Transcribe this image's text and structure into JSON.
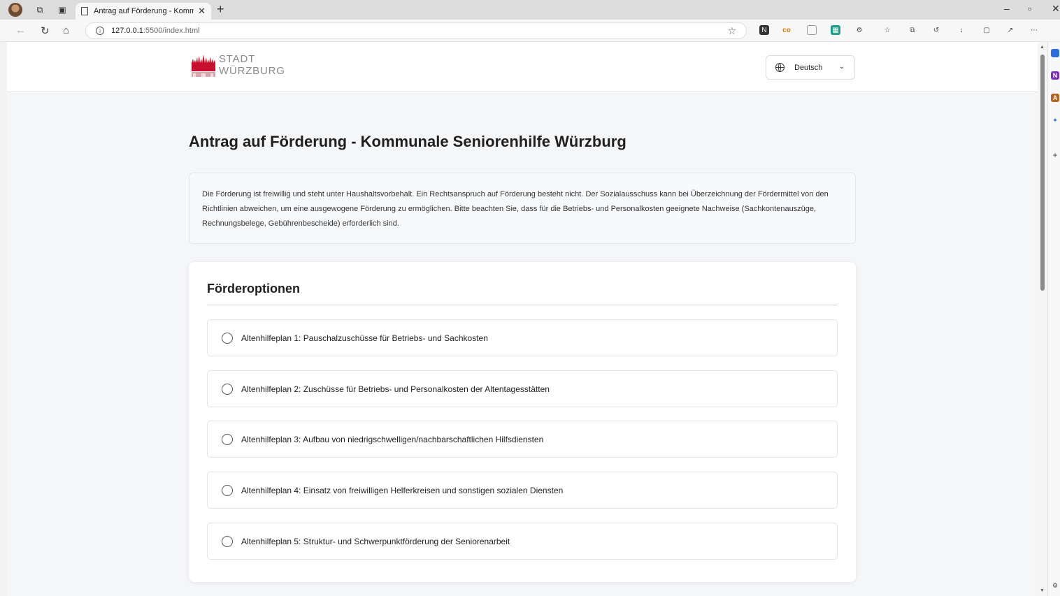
{
  "browser": {
    "tab_title": "Antrag auf Förderung - Kommuna",
    "url_host": "127.0.0.1",
    "url_path": ":5500/index.html"
  },
  "header": {
    "logo_line1": "STADT",
    "logo_line2": "WÜRZBURG",
    "language": "Deutsch"
  },
  "main": {
    "title": "Antrag auf Förderung - Kommunale Seniorenhilfe Würzburg",
    "notice": "Die Förderung ist freiwillig und steht unter Haushaltsvorbehalt. Ein Rechtsanspruch auf Förderung besteht nicht. Der Sozialausschuss kann bei Überzeichnung der Fördermittel von den Richtlinien abweichen, um eine ausgewogene Förderung zu ermöglichen. Bitte beachten Sie, dass für die Betriebs- und Personalkosten geeignete Nachweise (Sachkontenauszüge, Rechnungsbelege, Gebührenbescheide) erforderlich sind.",
    "options_title": "Förderoptionen",
    "options": [
      {
        "label": "Altenhilfeplan 1: Pauschalzuschüsse für Betriebs- und Sachkosten"
      },
      {
        "label": "Altenhilfeplan 2: Zuschüsse für Betriebs- und Personalkosten der Altentagesstätten"
      },
      {
        "label": "Altenhilfeplan 3: Aufbau von niedrigschwelligen/nachbarschaftlichen Hilfsdiensten"
      },
      {
        "label": "Altenhilfeplan 4: Einsatz von freiwilligen Helferkreisen und sonstigen sozialen Diensten"
      },
      {
        "label": "Altenhilfeplan 5: Struktur- und Schwerpunktförderung der Seniorenarbeit"
      }
    ]
  },
  "colors": {
    "brand_red": "#c8102e",
    "page_bg": "#f5f6f8"
  }
}
